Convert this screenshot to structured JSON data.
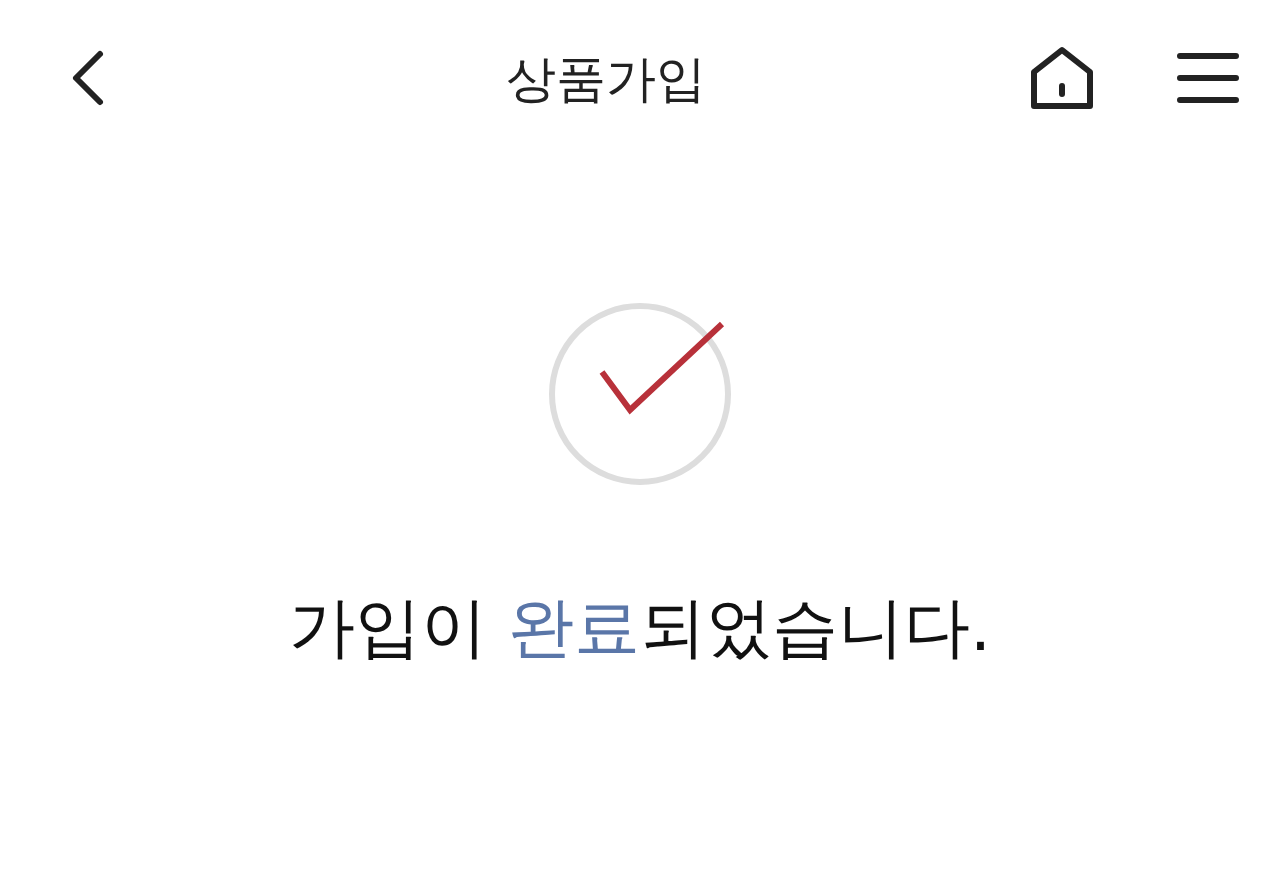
{
  "header": {
    "title": "상품가입"
  },
  "message": [
    {
      "text": "가입이 ",
      "highlight": false
    },
    {
      "text": "완료",
      "highlight": true
    },
    {
      "text": "되었습니다.",
      "highlight": false
    }
  ]
}
